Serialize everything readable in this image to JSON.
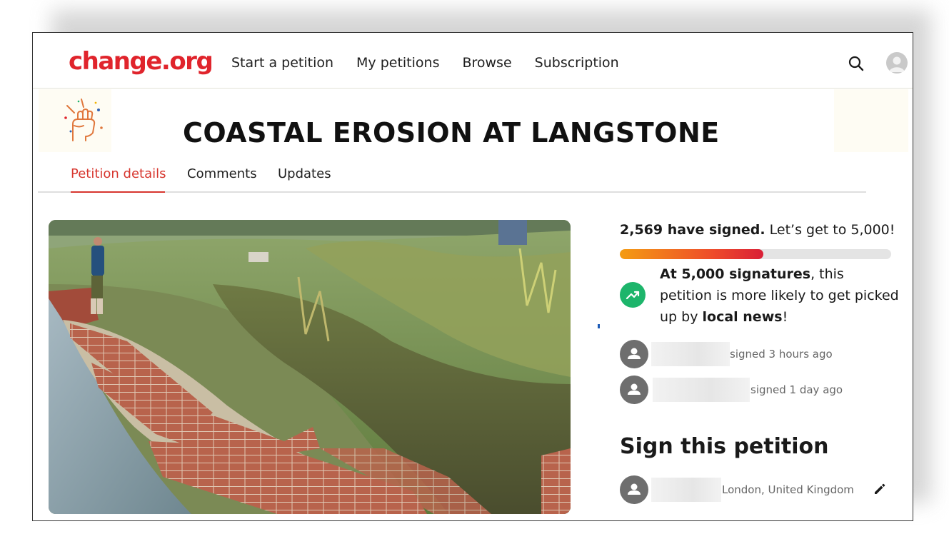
{
  "header": {
    "logo": "change.org",
    "nav": [
      "Start a petition",
      "My petitions",
      "Browse",
      "Subscription"
    ],
    "icons": {
      "search": "search-icon",
      "avatar": "user-avatar"
    }
  },
  "petition": {
    "title": "COASTAL EROSION AT LANGSTONE",
    "tabs": [
      "Petition details",
      "Comments",
      "Updates"
    ],
    "active_tab": "Petition details"
  },
  "signatures": {
    "count_text": "2,569 have signed.",
    "goal_text": " Let’s get to 5,000!",
    "count": 2569,
    "goal": 5000,
    "progress_fraction": 0.53
  },
  "milestone": {
    "bold_goal": "At 5,000 signatures",
    "middle": ", this petition is more likely to get picked up by ",
    "bold_outlet": "local news",
    "end": "!",
    "icon": "trending-up-icon"
  },
  "recent_signers": [
    {
      "meta": "signed 3 hours ago"
    },
    {
      "meta": "signed 1 day ago"
    }
  ],
  "sign_form": {
    "title": "Sign this petition",
    "location": "London, United Kingdom",
    "edit_icon": "pencil-icon"
  },
  "colors": {
    "brand_red": "#e0242c",
    "tab_active": "#d7362e",
    "milestone_green": "#1db56b",
    "progress_start": "#f49c12",
    "progress_end": "#d91f36"
  }
}
